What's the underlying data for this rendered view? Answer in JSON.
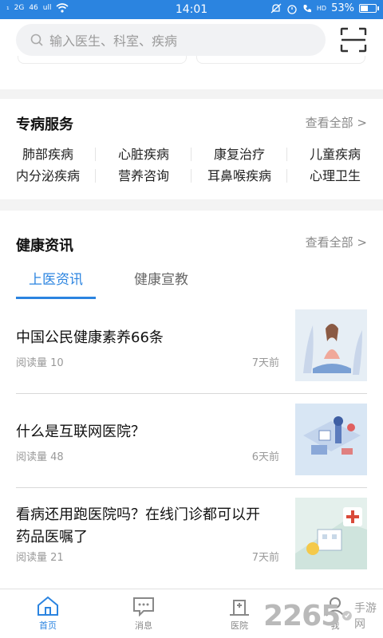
{
  "status_bar": {
    "left": [
      "₁",
      "2G",
      "46",
      "ull"
    ],
    "time": "14:01",
    "right": [
      "HD",
      "53%"
    ],
    "battery_level": 0.53
  },
  "search": {
    "placeholder": "输入医生、科室、疾病"
  },
  "specialty": {
    "title": "专病服务",
    "view_all": "查看全部 >",
    "items": [
      "肺部疾病",
      "心脏疾病",
      "康复治疗",
      "儿童疾病",
      "内分泌疾病",
      "营养咨询",
      "耳鼻喉疾病",
      "心理卫生"
    ]
  },
  "news": {
    "title": "健康资讯",
    "view_all": "查看全部 >",
    "tabs": [
      "上医资讯",
      "健康宣教"
    ],
    "articles": [
      {
        "title": "中国公民健康素养66条",
        "reads": "阅读量 10",
        "time": "7天前"
      },
      {
        "title": "什么是互联网医院？",
        "reads": "阅读量 48",
        "time": "6天前"
      },
      {
        "title": "看病还用跑医院吗？在线门诊都可以开药品医嘱了",
        "reads": "阅读量 21",
        "time": "7天前"
      }
    ]
  },
  "tabbar": {
    "items": [
      "首页",
      "消息",
      "医院",
      "我"
    ]
  },
  "watermark": {
    "number": "2265",
    "text": "手游网"
  },
  "colors": {
    "accent": "#2b84e0",
    "muted": "#999999",
    "divider": "#f3f3f3"
  }
}
